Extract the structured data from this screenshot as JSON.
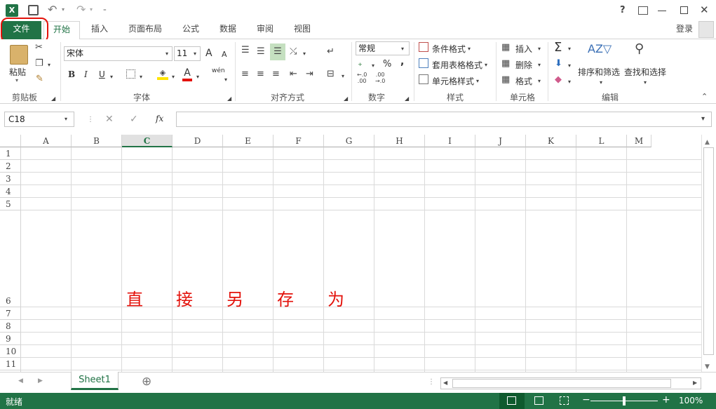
{
  "titlebar": {
    "app_icon": "excel-icon",
    "help": "?",
    "icons": [
      "save-icon",
      "undo-icon",
      "redo-icon",
      "customize-icon",
      "ribbon-display-icon",
      "minimize-icon",
      "maximize-icon",
      "close-icon"
    ]
  },
  "tabs": {
    "file": "文件",
    "home": "开始",
    "insert": "插入",
    "page_layout": "页面布局",
    "formulas": "公式",
    "data": "数据",
    "review": "审阅",
    "view": "视图",
    "login": "登录"
  },
  "ribbon": {
    "clipboard": {
      "paste": "粘贴",
      "label": "剪贴板"
    },
    "font": {
      "name": "宋体",
      "size": "11",
      "bold": "B",
      "italic": "I",
      "underline": "U",
      "phonetic": "wén",
      "label": "字体",
      "grow": "A",
      "shrink": "A",
      "font_color": "A"
    },
    "alignment": {
      "label": "对齐方式"
    },
    "number": {
      "format": "常规",
      "percent": "%",
      "comma": ",",
      "label": "数字",
      "inc_decimal": "←.0\n.00",
      "dec_decimal": ".00\n→.0"
    },
    "styles": {
      "conditional": "条件格式",
      "table": "套用表格格式",
      "cell": "单元格样式",
      "label": "样式"
    },
    "cells": {
      "insert": "插入",
      "delete": "删除",
      "format": "格式",
      "label": "单元格"
    },
    "editing": {
      "sort": "排序和筛选",
      "find": "查找和选择",
      "label": "编辑",
      "sum": "Σ"
    }
  },
  "formula_bar": {
    "name_box": "C18",
    "fx": "fx",
    "cancel": "✕",
    "enter": "✓",
    "value": ""
  },
  "grid": {
    "columns": [
      "A",
      "B",
      "C",
      "D",
      "E",
      "F",
      "G",
      "H",
      "I",
      "J",
      "K",
      "L",
      "M"
    ],
    "rows": [
      "1",
      "2",
      "3",
      "4",
      "5",
      "6",
      "7",
      "8",
      "9",
      "10",
      "11"
    ],
    "cells": [
      "直",
      "接",
      "另",
      "存",
      "为"
    ],
    "selected_column": "C"
  },
  "sheets": {
    "active": "Sheet1",
    "add": "⊕"
  },
  "status": {
    "text": "就绪",
    "zoom": "100%",
    "zoom_out": "−",
    "zoom_in": "+"
  },
  "colors": {
    "excel_green": "#217346",
    "annotation_red": "#e3120b"
  }
}
